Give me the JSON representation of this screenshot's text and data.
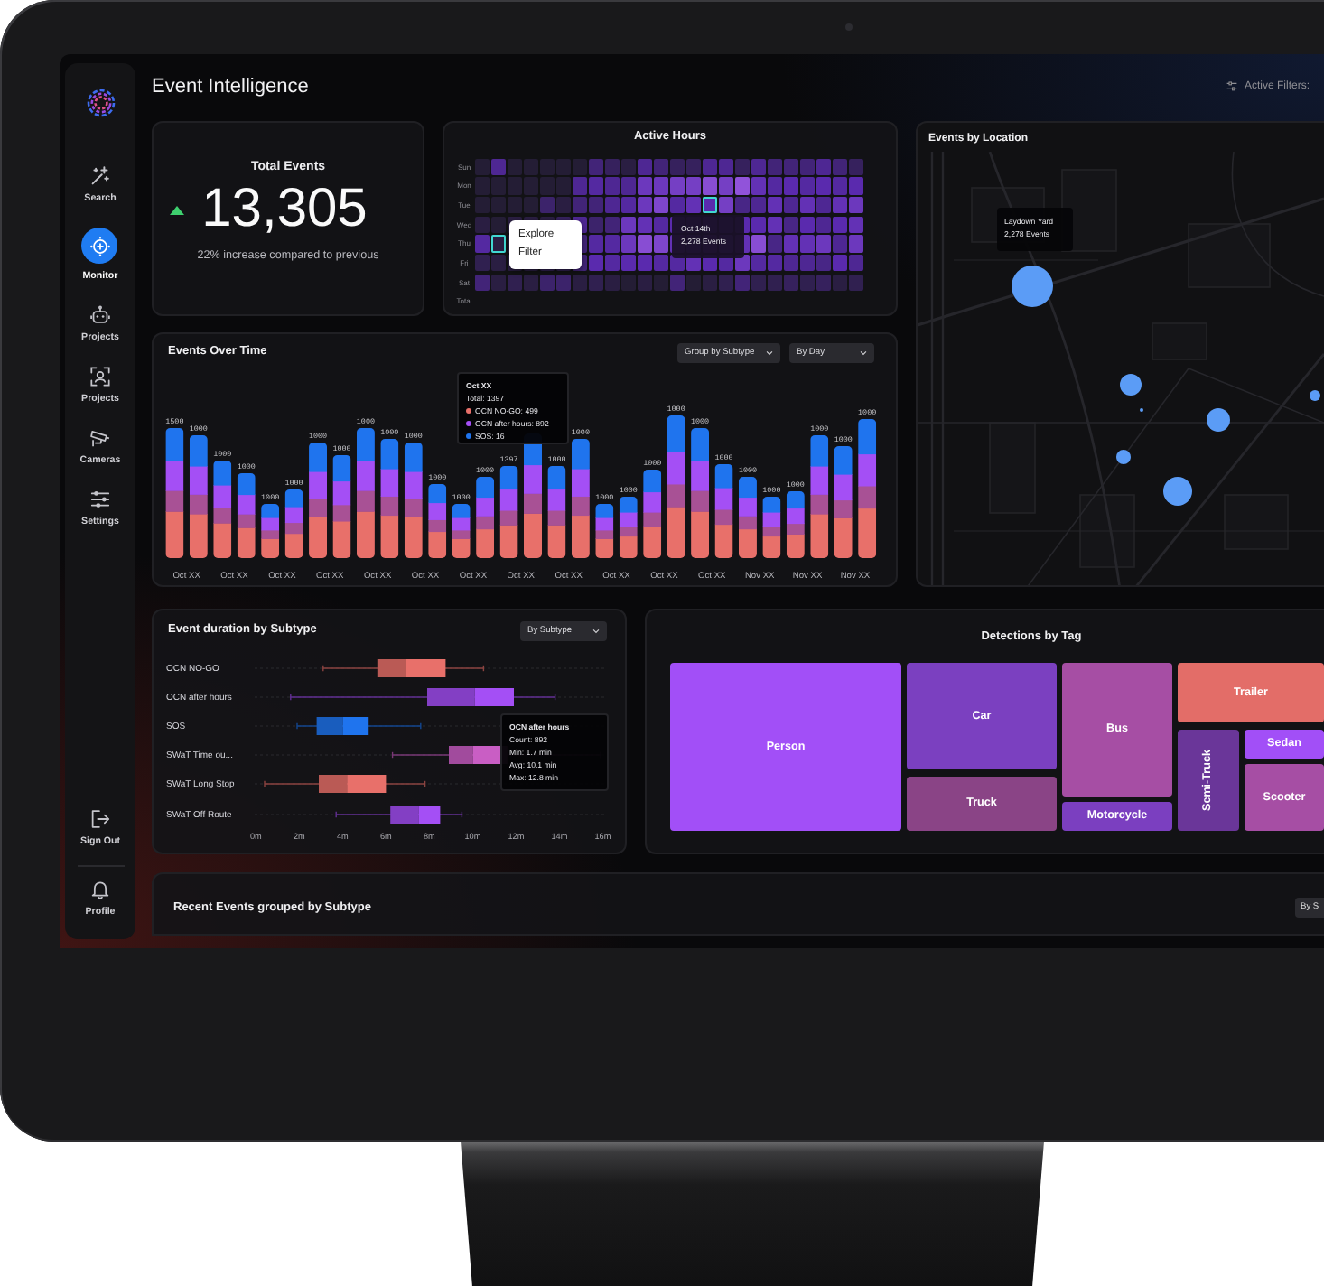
{
  "sidebar": {
    "items": [
      {
        "label": "Search",
        "selected": false
      },
      {
        "label": "Monitor",
        "selected": true
      },
      {
        "label": "Projects",
        "selected": false
      },
      {
        "label": "Projects",
        "selected": false
      },
      {
        "label": "Cameras",
        "selected": false
      },
      {
        "label": "Settings",
        "selected": false
      }
    ],
    "bottom_items": [
      {
        "label": "Sign Out",
        "selected": false
      },
      {
        "label": "Profile",
        "selected": false
      }
    ]
  },
  "header": {
    "title": "Event Intelligence",
    "filters_label": "Active Filters:"
  },
  "total_events": {
    "title": "Total Events",
    "value": "13,305",
    "note": "22% increase compared to previous"
  },
  "active_hours": {
    "title": "Active Hours",
    "day_labels": [
      "Sun",
      "Mon",
      "Tue",
      "Wed",
      "Thu",
      "Fri",
      "Sat"
    ],
    "total_label": "Total",
    "menu": [
      "Explore",
      "Filter"
    ],
    "tooltip": {
      "title": "Oct 14th",
      "text": "2,278 Events"
    }
  },
  "events_by_location": {
    "title": "Events by Location",
    "tooltip": {
      "title": "Laydown Yard",
      "text": "2,278 Events"
    }
  },
  "events_over_time": {
    "title": "Events Over Time",
    "dropdowns": [
      "Group by Subtype",
      "By Day"
    ],
    "bars": [
      {
        "kind": "labeled",
        "label": "1500"
      },
      {
        "kind": "labeled",
        "label": "1000"
      },
      {
        "kind": "labeled",
        "label": "1000"
      },
      {
        "kind": "labeled",
        "label": "1000"
      },
      {
        "kind": "labeled",
        "label": "1000"
      },
      {
        "kind": "labeled",
        "label": "1000"
      },
      {
        "kind": "labeled",
        "label": "1000"
      },
      {
        "kind": "labeled",
        "label": "1000"
      },
      {
        "kind": "labeled",
        "label": "1000"
      },
      {
        "kind": "labeled",
        "label": "1000"
      },
      {
        "kind": "labeled",
        "label": "1000"
      },
      {
        "kind": "labeled",
        "label": "1000"
      },
      {
        "kind": "labeled",
        "label": "1000"
      },
      {
        "kind": "labeled",
        "label": "1000"
      },
      {
        "kind": "labeled",
        "label": "1397"
      },
      {
        "kind": "unlabeled"
      },
      {
        "kind": "labeled",
        "label": "1000"
      },
      {
        "kind": "labeled",
        "label": "1000"
      },
      {
        "kind": "labeled",
        "label": "1000"
      },
      {
        "kind": "labeled",
        "label": "1000"
      },
      {
        "kind": "labeled",
        "label": "1000"
      },
      {
        "kind": "labeled",
        "label": "1000"
      },
      {
        "kind": "labeled",
        "label": "1000"
      },
      {
        "kind": "labeled",
        "label": "1000"
      },
      {
        "kind": "labeled",
        "label": "1000"
      },
      {
        "kind": "labeled",
        "label": "1000"
      },
      {
        "kind": "labeled",
        "label": "1000"
      },
      {
        "kind": "labeled",
        "label": "1000"
      },
      {
        "kind": "labeled",
        "label": "1000"
      },
      {
        "kind": "labeled",
        "label": "1000"
      }
    ],
    "x_labels": [
      "Oct XX",
      "Oct XX",
      "Oct XX",
      "Oct XX",
      "Oct XX",
      "Oct XX",
      "Oct XX",
      "Oct XX",
      "Oct XX",
      "Oct XX",
      "Oct XX",
      "Oct XX",
      "Nov XX",
      "Nov XX",
      "Nov XX"
    ],
    "tooltip": {
      "title": "Oct XX",
      "total": "Total: 1397",
      "items": [
        {
          "label": "OCN NO-GO: 499",
          "color": "#e8706a"
        },
        {
          "label": "OCN after hours: 892",
          "color": "#a44ff5"
        },
        {
          "label": "SOS: 16",
          "color": "#1f74ee"
        }
      ]
    }
  },
  "event_duration": {
    "title": "Event duration by Subtype",
    "dropdown": "By Subtype",
    "rows": [
      {
        "label": "OCN NO-GO",
        "color": "#e8706a"
      },
      {
        "label": "OCN after hours",
        "color": "#a44ff5"
      },
      {
        "label": "SOS",
        "color": "#1f74ee"
      },
      {
        "label": "SWaT Time ou...",
        "color": "#c95ec4"
      },
      {
        "label": "SWaT Long Stop",
        "color": "#e8706a"
      },
      {
        "label": "SWaT Off Route",
        "color": "#a44ff5"
      }
    ],
    "x_ticks": [
      "0m",
      "2m",
      "4m",
      "6m",
      "8m",
      "10m",
      "12m",
      "14m",
      "16m"
    ],
    "tooltip": {
      "title": "OCN after hours",
      "lines": [
        "Count: 892",
        "Min: 1.7 min",
        "Avg: 10.1 min",
        "Max: 12.8 min"
      ]
    }
  },
  "detections_by_tag": {
    "title": "Detections by Tag",
    "tiles": [
      {
        "label": "Person",
        "color": "#a24ff7",
        "kind": "horizontal"
      },
      {
        "label": "Car",
        "color": "#7b40c0",
        "kind": "horizontal"
      },
      {
        "label": "Truck",
        "color": "#8a4486",
        "kind": "horizontal"
      },
      {
        "label": "Bus",
        "color": "#a64ea4",
        "kind": "horizontal"
      },
      {
        "label": "Motorcycle",
        "color": "#7b3fc0",
        "kind": "horizontal"
      },
      {
        "label": "Trailer",
        "color": "#e36d68",
        "kind": "horizontal"
      },
      {
        "label": "Semi-Truck",
        "color": "#6a3699",
        "kind": "vertical"
      },
      {
        "label": "Sedan",
        "color": "#a24ff7",
        "kind": "horizontal"
      },
      {
        "label": "Scooter",
        "color": "#a64ea4",
        "kind": "horizontal"
      }
    ]
  },
  "recent_events": {
    "title": "Recent Events grouped by Subtype",
    "button": "By S"
  }
}
